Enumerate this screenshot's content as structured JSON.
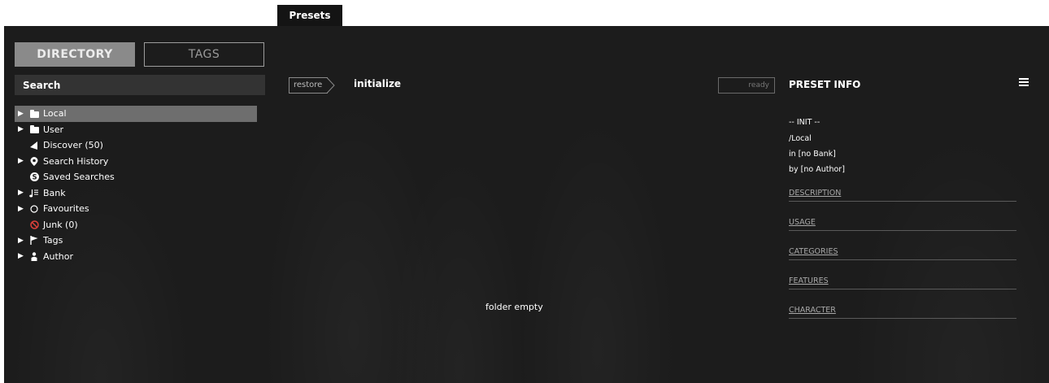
{
  "top_tab": {
    "label": "Presets"
  },
  "left": {
    "directory_label": "DIRECTORY",
    "tags_label": "TAGS",
    "search_placeholder": "Search",
    "tree": [
      {
        "label": "Local",
        "icon": "folder-icon",
        "expandable": true,
        "selected": true
      },
      {
        "label": "User",
        "icon": "folder-icon",
        "expandable": true,
        "selected": false
      },
      {
        "label": "Discover (50)",
        "icon": "discover-icon",
        "expandable": false,
        "selected": false
      },
      {
        "label": "Search History",
        "icon": "location-pin-icon",
        "expandable": true,
        "selected": false
      },
      {
        "label": "Saved Searches",
        "icon": "saved-search-icon",
        "expandable": false,
        "selected": false
      },
      {
        "label": "Bank",
        "icon": "bank-icon",
        "expandable": true,
        "selected": false
      },
      {
        "label": "Favourites",
        "icon": "circle-icon",
        "expandable": true,
        "selected": false
      },
      {
        "label": "Junk (0)",
        "icon": "prohibited-icon",
        "expandable": false,
        "selected": false
      },
      {
        "label": "Tags",
        "icon": "flag-icon",
        "expandable": true,
        "selected": false
      },
      {
        "label": "Author",
        "icon": "person-icon",
        "expandable": true,
        "selected": false
      }
    ]
  },
  "center": {
    "restore_label": "restore",
    "preset_name": "initialize",
    "status": "ready",
    "empty_message": "folder empty"
  },
  "info": {
    "title": "PRESET INFO",
    "name": "-- INIT --",
    "path": "/Local",
    "bank": "in [no Bank]",
    "author": "by [no Author]",
    "sections": [
      "DESCRIPTION",
      "USAGE",
      "CATEGORIES",
      "FEATURES",
      "CHARACTER"
    ]
  },
  "colors": {
    "panel_bg": "#1c1c1c",
    "selected_row": "#6e6e6e",
    "directory_button": "#8a8a8a",
    "prohibited_icon": "#e0413a"
  }
}
